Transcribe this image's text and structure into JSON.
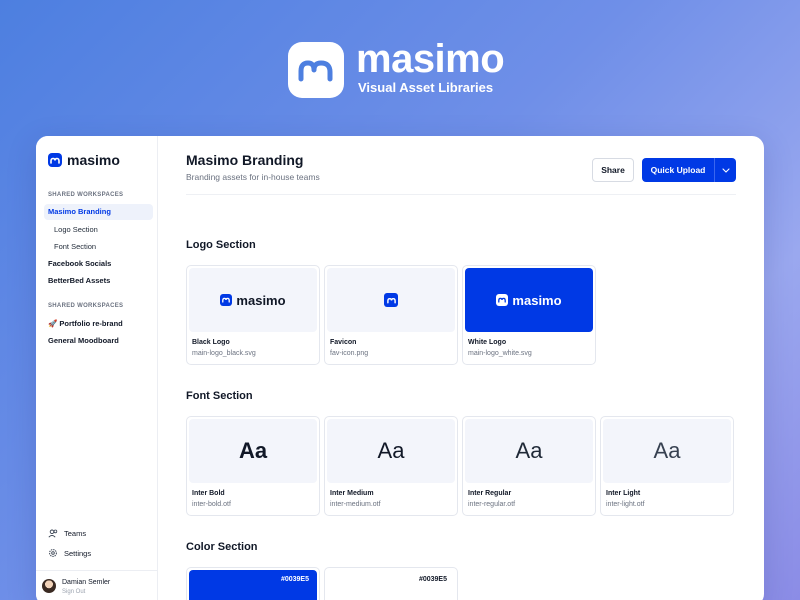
{
  "hero": {
    "title": "masimo",
    "tagline": "Visual Asset Libraries",
    "logo_icon": "masimo-arch-icon"
  },
  "sidebar": {
    "brand": "masimo",
    "section1": "SHARED WORKSPACES",
    "items": [
      {
        "label": "Masimo Branding",
        "active": true
      },
      {
        "label": "Logo Section"
      },
      {
        "label": "Font Section"
      },
      {
        "label": "Facebook Socials"
      },
      {
        "label": "BetterBed Assets"
      }
    ],
    "section2": "SHARED WORKSPACES",
    "items2": [
      {
        "label": "🚀 Portfolio re-brand"
      },
      {
        "label": "General Moodboard"
      }
    ],
    "teams": "Teams",
    "settings": "Settings",
    "user": {
      "name": "Damian Semler",
      "action": "Sign Out"
    }
  },
  "header": {
    "title": "Masimo Branding",
    "subtitle": "Branding assets for in-house teams",
    "share": "Share",
    "upload": "Quick Upload"
  },
  "logo_section": {
    "title": "Logo Section",
    "cards": [
      {
        "name": "Black Logo",
        "file": "main-logo_black.svg",
        "preview_text": "masimo"
      },
      {
        "name": "Favicon",
        "file": "fav-icon.png"
      },
      {
        "name": "White Logo",
        "file": "main-logo_white.svg",
        "preview_text": "masimo"
      }
    ]
  },
  "font_section": {
    "title": "Font Section",
    "cards": [
      {
        "sample": "Aa",
        "name": "Inter Bold",
        "file": "inter-bold.otf"
      },
      {
        "sample": "Aa",
        "name": "Inter Medium",
        "file": "inter-medium.otf"
      },
      {
        "sample": "Aa",
        "name": "Inter Regular",
        "file": "inter-regular.otf"
      },
      {
        "sample": "Aa",
        "name": "Inter Light",
        "file": "inter-light.otf"
      }
    ]
  },
  "color_section": {
    "title": "Color Section",
    "swatches": [
      {
        "hex": "#0039E5",
        "color": "#0039e5"
      },
      {
        "hex": "#0039E5",
        "color": "#ffffff"
      }
    ]
  },
  "colors": {
    "accent": "#0039e5",
    "active_bg": "#eef2fb"
  }
}
